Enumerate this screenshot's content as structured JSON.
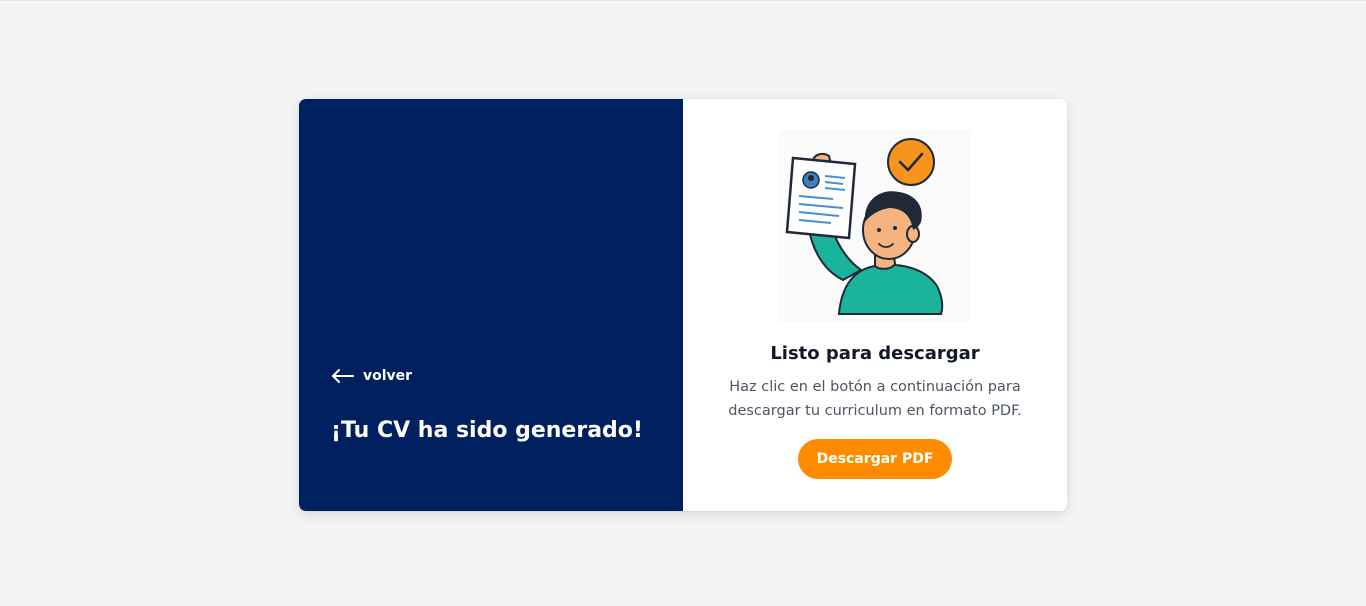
{
  "back": {
    "label": "volver",
    "icon": "arrow-left-icon"
  },
  "left": {
    "headline": "¡Tu CV ha sido generado!"
  },
  "right": {
    "illustration": "person-holding-cv-illustration",
    "title": "Listo para descargar",
    "description": "Haz clic en el botón a continuación para descargar tu curriculum en formato PDF.",
    "download_label": "Descargar PDF"
  },
  "colors": {
    "page_bg": "#f3f4f6",
    "panel_navy": "#002060",
    "accent_orange": "#ff8c00",
    "card_bg": "#ffffff"
  }
}
